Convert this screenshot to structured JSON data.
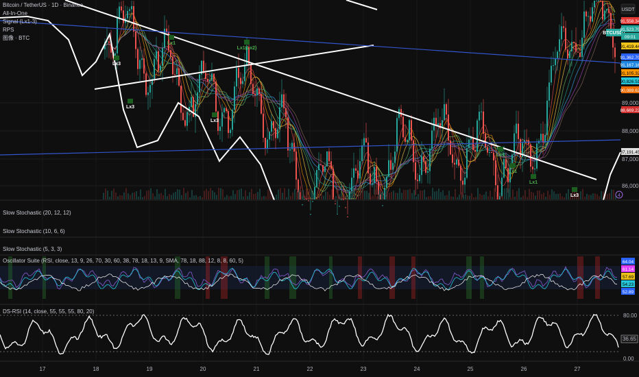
{
  "header": {
    "title": "Bitcoin / TetherUS · 1D · Binance",
    "indicators": [
      "All-In-One",
      "Signal (Lx1-3)",
      "RPS",
      "图像 · BTC"
    ],
    "currency_button": "USDT"
  },
  "colors": {
    "background": "#0f0f0f",
    "grid": "#1e1e1e",
    "price_line": "#ffffff",
    "trend_blue": "#3355cc",
    "separator": "#2a2a2a"
  },
  "price_pane": {
    "y_ticks": [
      "89,000.00",
      "88,000.00",
      "87,000.00",
      "86,000.00"
    ],
    "symbol_badge": "BTCUSDT",
    "badges": [
      {
        "text": "91,558.34",
        "color": "#e53935",
        "text_color": "#ffffff"
      },
      {
        "text": "91,523.70",
        "color": "#26a69a",
        "text_color": "#ffffff"
      },
      {
        "text": "09:01",
        "color": "#26a69a",
        "text_color": "#ffffff"
      },
      {
        "text": "91,419.44",
        "color": "#f0c419",
        "text_color": "#000000"
      },
      {
        "text": "91,362.70",
        "color": "#2962ff",
        "text_color": "#ffffff"
      },
      {
        "text": "91,167.16",
        "color": "#1e88e5",
        "text_color": "#ffffff"
      },
      {
        "text": "91,105.32",
        "color": "#ff9800",
        "text_color": "#000000"
      },
      {
        "text": "90,826.51",
        "color": "#26c6da",
        "text_color": "#000000"
      },
      {
        "text": "90,089.62",
        "color": "#ef6c00",
        "text_color": "#ffffff"
      },
      {
        "text": "88,669.22",
        "color": "#d32f2f",
        "text_color": "#ffffff"
      },
      {
        "text": "87,191.45",
        "color": "#e0e0e0",
        "text_color": "#000000"
      }
    ],
    "signals": [
      "Lx3",
      "Lx3",
      "Lx3",
      "Lx1",
      "Lx1(Lx2)",
      "Lx1",
      "Lx1",
      "Lx1",
      "Lx3"
    ]
  },
  "panes": {
    "stoch1": "Slow Stochastic (20, 12, 12)",
    "stoch2": "Slow Stochastic (10, 6, 6)",
    "stoch3": "Slow Stochastic (5, 3, 3)",
    "osc": "Oscillator Suite (RSI, close, 13, 9, 26, 70, 30, 60, 38, 78, 18, 13, 9, SMA, 78, 18, 88, 12, 8, 8, 60, 5)",
    "osc_badges": [
      {
        "text": "64.04",
        "color": "#2962ff"
      },
      {
        "text": "61.14",
        "color": "#e040fb"
      },
      {
        "text": "57.69",
        "color": "#f0c419"
      },
      {
        "text": "54.23",
        "color": "#26c6da"
      },
      {
        "text": "52.89",
        "color": "#2962ff"
      }
    ],
    "dsrsi": "DS-RSI (14, close, 55, 55, 55, 80, 20)",
    "dsrsi_ticks": [
      "80.00",
      "0.00"
    ],
    "dsrsi_badge": "36.65"
  },
  "x_axis": {
    "labels": [
      "17",
      "18",
      "19",
      "20",
      "21",
      "22",
      "23",
      "24",
      "25",
      "26",
      "27"
    ]
  },
  "chart_data": {
    "type": "line",
    "x": [
      "17",
      "18",
      "19",
      "20",
      "21",
      "22",
      "23",
      "24",
      "25",
      "26",
      "27"
    ],
    "series": [
      {
        "values": [
          91900,
          91700,
          90200,
          88900,
          89200,
          86000,
          86500,
          87600,
          87300,
          86900,
          91500
        ]
      }
    ],
    "ylim": [
      85800,
      92000
    ],
    "grid": true,
    "dsrsi_levels": [
      80,
      20
    ]
  }
}
